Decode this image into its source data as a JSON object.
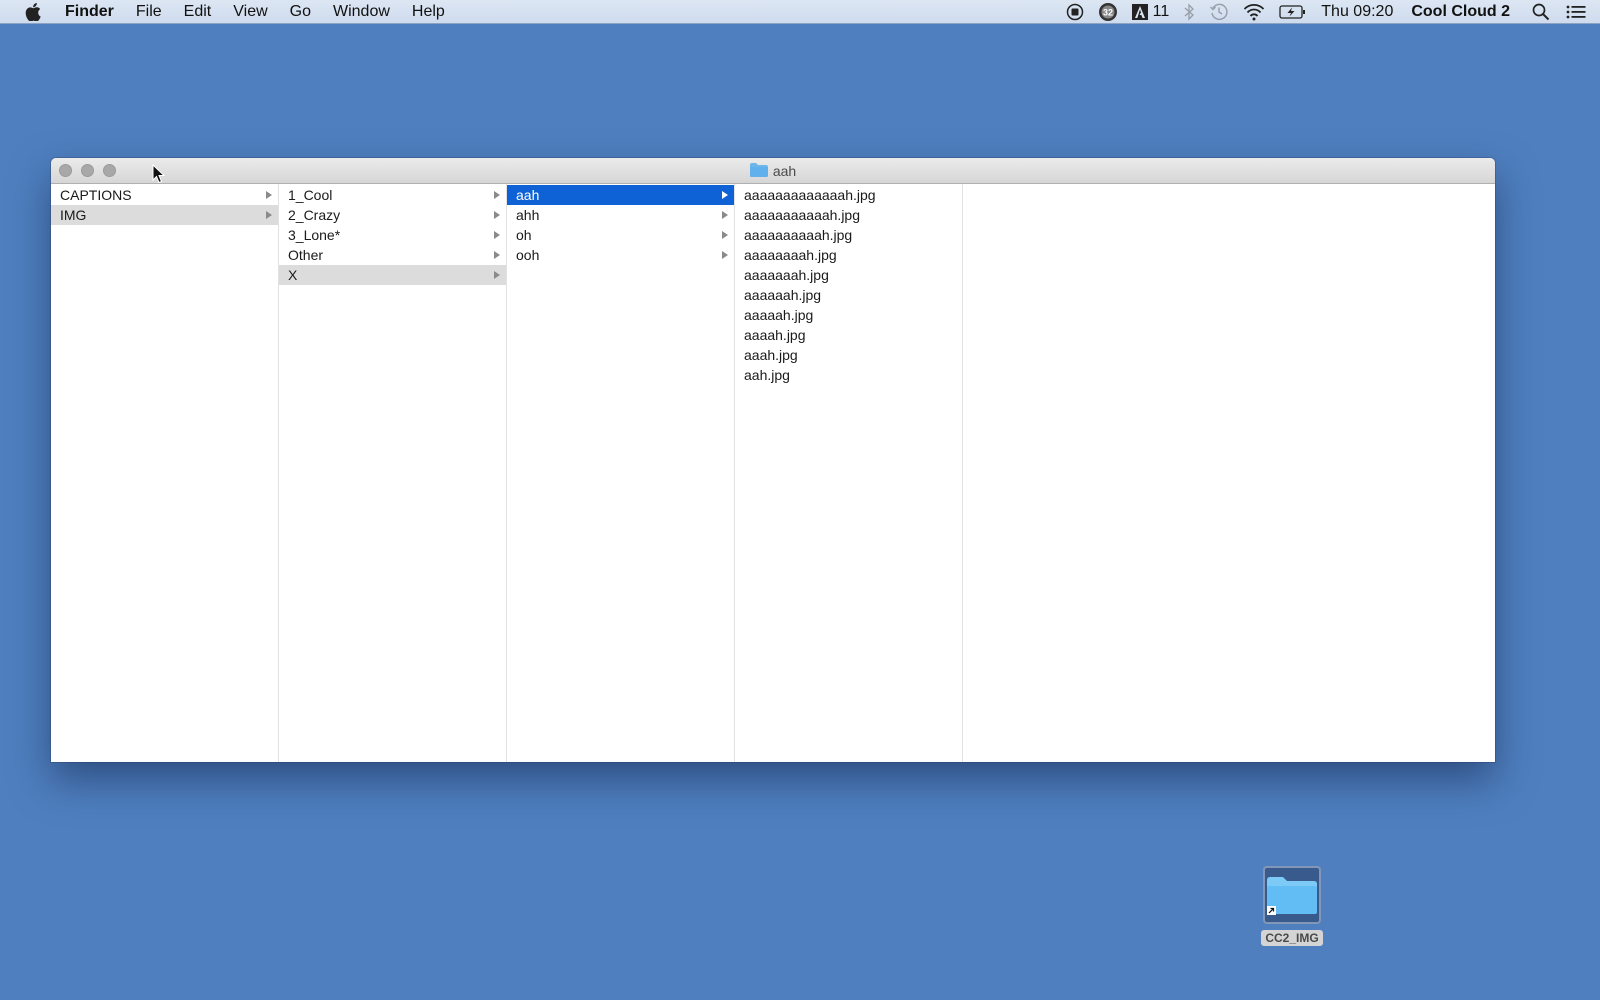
{
  "menubar": {
    "apple_icon": "apple-logo-icon",
    "app_name": "Finder",
    "menus": [
      "File",
      "Edit",
      "View",
      "Go",
      "Window",
      "Help"
    ],
    "status_items": [
      {
        "name": "record-icon"
      },
      {
        "name": "calendar-32-icon",
        "text": "32"
      },
      {
        "name": "adobe-icon",
        "text": "11"
      },
      {
        "name": "bluetooth-icon"
      },
      {
        "name": "time-machine-icon"
      },
      {
        "name": "wifi-icon"
      },
      {
        "name": "battery-charging-icon"
      }
    ],
    "adobe_count": "11",
    "calendar_badge": "32",
    "clock": "Thu 09:20",
    "user": "Cool Cloud 2"
  },
  "window": {
    "title": "aah",
    "columns": [
      {
        "items": [
          {
            "label": "CAPTIONS",
            "folder": true,
            "state": "none"
          },
          {
            "label": "IMG",
            "folder": true,
            "state": "inactive"
          }
        ]
      },
      {
        "items": [
          {
            "label": "1_Cool",
            "folder": true,
            "state": "none"
          },
          {
            "label": "2_Crazy",
            "folder": true,
            "state": "none"
          },
          {
            "label": "3_Lone*",
            "folder": true,
            "state": "none"
          },
          {
            "label": "Other",
            "folder": true,
            "state": "none"
          },
          {
            "label": "X",
            "folder": true,
            "state": "inactive"
          }
        ]
      },
      {
        "items": [
          {
            "label": "aah",
            "folder": true,
            "state": "active"
          },
          {
            "label": "ahh",
            "folder": true,
            "state": "none"
          },
          {
            "label": "oh",
            "folder": true,
            "state": "none"
          },
          {
            "label": "ooh",
            "folder": true,
            "state": "none"
          }
        ]
      },
      {
        "items": [
          {
            "label": "aaaaaaaaaaaaah.jpg",
            "folder": false,
            "state": "none"
          },
          {
            "label": "aaaaaaaaaaah.jpg",
            "folder": false,
            "state": "none"
          },
          {
            "label": "aaaaaaaaaah.jpg",
            "folder": false,
            "state": "none"
          },
          {
            "label": "aaaaaaaah.jpg",
            "folder": false,
            "state": "none"
          },
          {
            "label": "aaaaaaah.jpg",
            "folder": false,
            "state": "none"
          },
          {
            "label": "aaaaaah.jpg",
            "folder": false,
            "state": "none"
          },
          {
            "label": "aaaaah.jpg",
            "folder": false,
            "state": "none"
          },
          {
            "label": "aaaah.jpg",
            "folder": false,
            "state": "none"
          },
          {
            "label": "aaah.jpg",
            "folder": false,
            "state": "none"
          },
          {
            "label": "aah.jpg",
            "folder": false,
            "state": "none"
          }
        ]
      },
      {
        "items": []
      }
    ]
  },
  "desktop": {
    "icons": [
      {
        "label": "CC2_IMG",
        "type": "folder-alias"
      }
    ]
  },
  "colors": {
    "desktop": "#4f7fbf",
    "selection_active": "#0f62d6",
    "selection_inactive": "#dcdcdc"
  }
}
